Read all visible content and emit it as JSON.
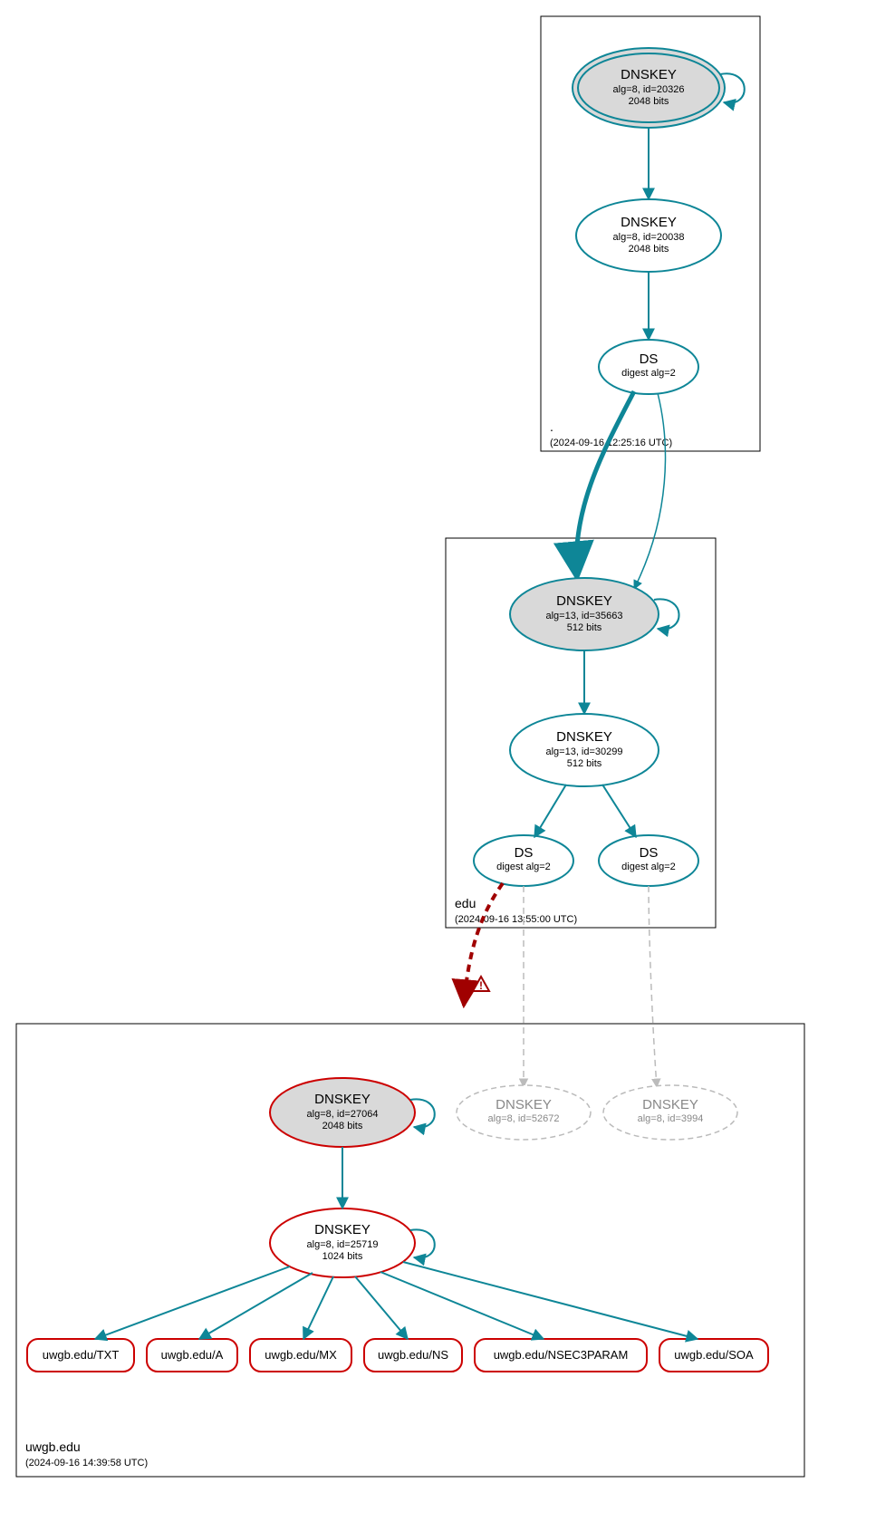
{
  "colors": {
    "teal": "#0e8697",
    "red": "#cc0000",
    "darkred": "#a00000",
    "gray": "#bbbbbb",
    "lightfill": "#d9d9d9",
    "black": "#000000"
  },
  "zones": {
    "root": {
      "label": ".",
      "timestamp": "(2024-09-16 12:25:16 UTC)",
      "nodes": {
        "ksk": {
          "title": "DNSKEY",
          "sub1": "alg=8, id=20326",
          "sub2": "2048 bits"
        },
        "zsk": {
          "title": "DNSKEY",
          "sub1": "alg=8, id=20038",
          "sub2": "2048 bits"
        },
        "ds": {
          "title": "DS",
          "sub1": "digest alg=2"
        }
      }
    },
    "edu": {
      "label": "edu",
      "timestamp": "(2024-09-16 13:55:00 UTC)",
      "nodes": {
        "ksk": {
          "title": "DNSKEY",
          "sub1": "alg=13, id=35663",
          "sub2": "512 bits"
        },
        "zsk": {
          "title": "DNSKEY",
          "sub1": "alg=13, id=30299",
          "sub2": "512 bits"
        },
        "ds1": {
          "title": "DS",
          "sub1": "digest alg=2"
        },
        "ds2": {
          "title": "DS",
          "sub1": "digest alg=2"
        }
      }
    },
    "uwgb": {
      "label": "uwgb.edu",
      "timestamp": "(2024-09-16 14:39:58 UTC)",
      "nodes": {
        "ksk": {
          "title": "DNSKEY",
          "sub1": "alg=8, id=27064",
          "sub2": "2048 bits"
        },
        "zsk": {
          "title": "DNSKEY",
          "sub1": "alg=8, id=25719",
          "sub2": "1024 bits"
        },
        "ghost1": {
          "title": "DNSKEY",
          "sub1": "alg=8, id=52672"
        },
        "ghost2": {
          "title": "DNSKEY",
          "sub1": "alg=8, id=3994"
        }
      },
      "records": {
        "txt": "uwgb.edu/TXT",
        "a": "uwgb.edu/A",
        "mx": "uwgb.edu/MX",
        "ns": "uwgb.edu/NS",
        "nsec3param": "uwgb.edu/NSEC3PARAM",
        "soa": "uwgb.edu/SOA"
      }
    }
  }
}
